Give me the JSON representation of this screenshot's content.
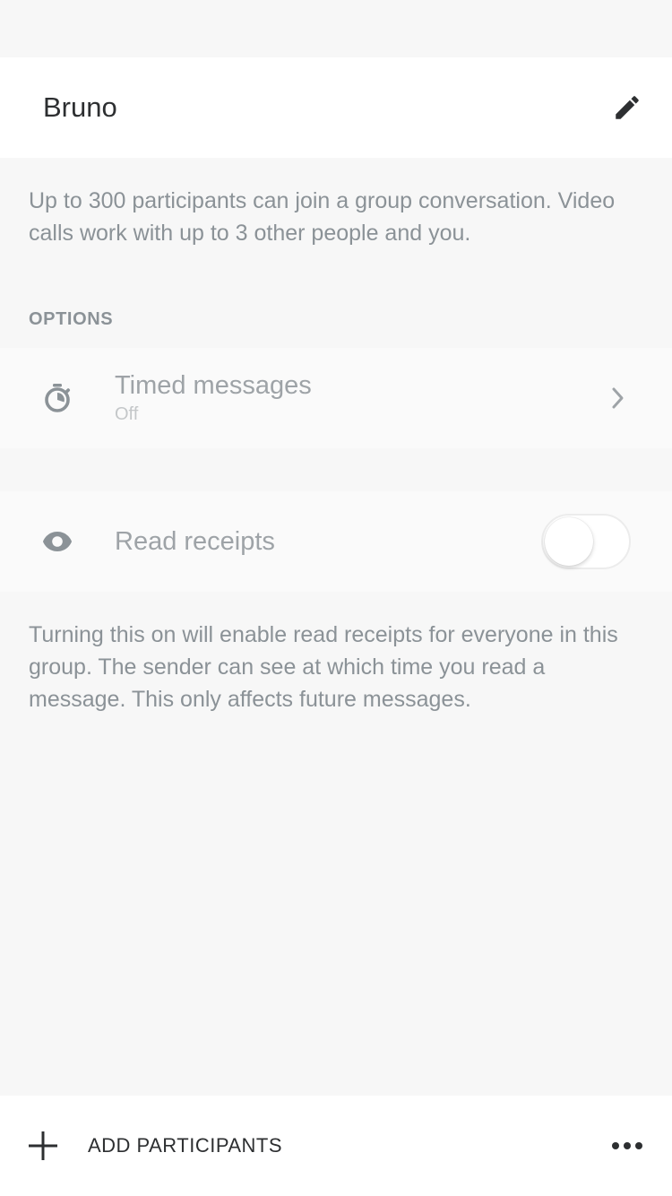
{
  "conversation": {
    "name": "Bruno"
  },
  "info": {
    "participants_text": "Up to 300 participants can join a group conversation. Video calls work with up to 3 other people and you."
  },
  "options": {
    "header": "OPTIONS",
    "timed_messages": {
      "title": "Timed messages",
      "subtitle": "Off",
      "icon": "timer-icon"
    },
    "read_receipts": {
      "title": "Read receipts",
      "enabled": false,
      "icon": "eye-icon",
      "description": "Turning this on will enable read receipts for everyone in this group. The sender can see at which time you read a message. This only affects future messages."
    }
  },
  "footer": {
    "add_label": "ADD PARTICIPANTS"
  },
  "colors": {
    "background": "#f7f7f7",
    "text_dark": "#2d2f31",
    "text_muted": "#8b9297",
    "icon_gray": "#8b9297"
  }
}
